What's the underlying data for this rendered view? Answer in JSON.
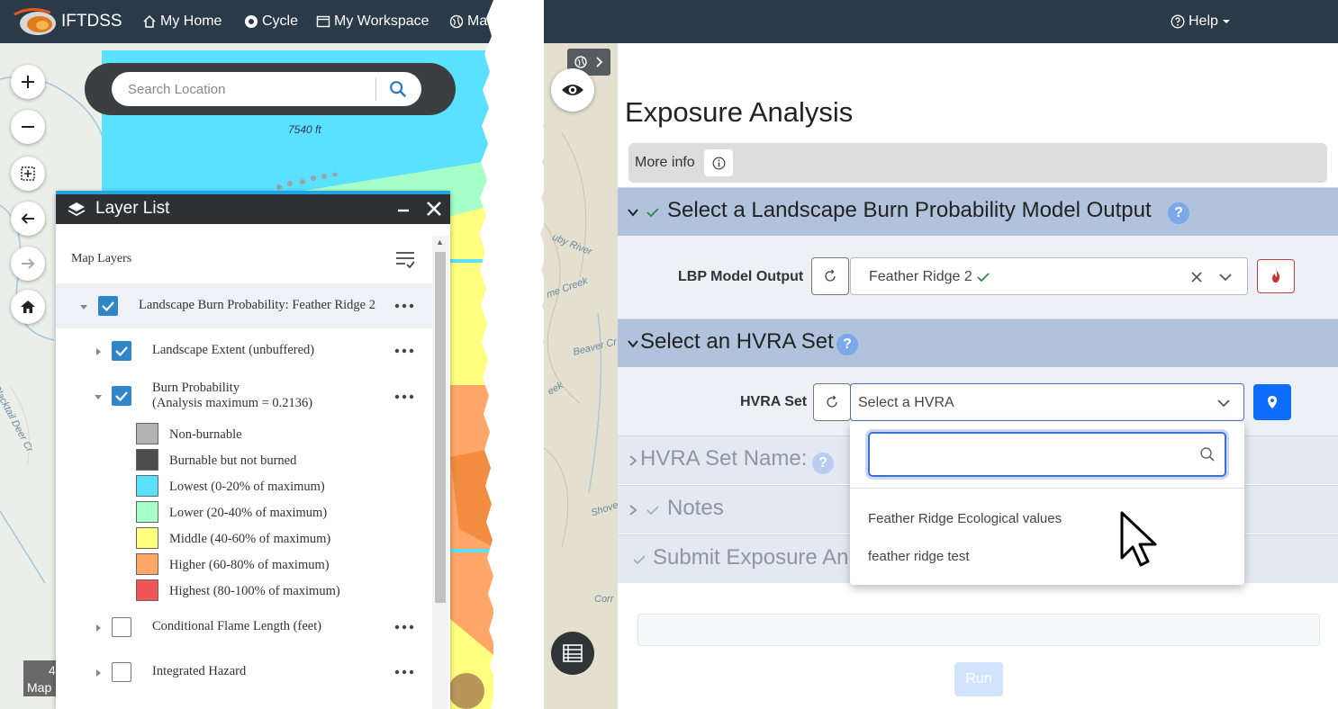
{
  "app": {
    "brand": "IFTDSS",
    "nav_left": [
      {
        "label": "My Home",
        "icon": "home-icon"
      },
      {
        "label": "Cycle",
        "icon": "cycle-icon"
      },
      {
        "label": "My Workspace",
        "icon": "workspace-icon"
      },
      {
        "label": "Ma",
        "icon": "globe-icon"
      }
    ],
    "nav_right": {
      "label": "Help",
      "icon": "question-circle-icon"
    }
  },
  "map": {
    "search_placeholder": "Search Location",
    "elevation_label": "7540 ft",
    "scale_prefix": "4",
    "map_tag": "Map",
    "map_labels_right": [
      "uby River",
      "me Creek",
      "Beaver Cr",
      "eek",
      "Shove",
      "Corr"
    ],
    "map_label_left": "Blacktail Deer Cr"
  },
  "layer_list": {
    "title": "Layer List",
    "map_layers_label": "Map Layers",
    "layers": [
      {
        "name": "Landscape Burn Probability: Feather Ridge 2",
        "checked": true
      },
      {
        "name": "Landscape Extent (unbuffered)",
        "checked": true
      },
      {
        "name": "Burn Probability",
        "sub": "(Analysis maximum = 0.2136)",
        "checked": true
      },
      {
        "name": "Conditional Flame Length (feet)",
        "checked": false
      },
      {
        "name": "Integrated Hazard",
        "checked": false
      }
    ],
    "legend": [
      {
        "label": "Non-burnable",
        "color": "#b3b3b3"
      },
      {
        "label": "Burnable but not burned",
        "color": "#4d4d4d"
      },
      {
        "label": "Lowest (0-20% of maximum)",
        "color": "#59e1ff"
      },
      {
        "label": "Lower (20-40% of maximum)",
        "color": "#a6ffc9"
      },
      {
        "label": "Middle (40-60% of maximum)",
        "color": "#ffff80"
      },
      {
        "label": "Higher (60-80% of maximum)",
        "color": "#ffa768"
      },
      {
        "label": "Highest (80-100% of maximum)",
        "color": "#f25555"
      }
    ]
  },
  "panel": {
    "title": "Exposure Analysis",
    "more_info": "More info",
    "sections": {
      "lbp": {
        "title": "Select a Landscape Burn Probability Model Output",
        "field_label": "LBP Model Output",
        "value": "Feather Ridge 2"
      },
      "hvra": {
        "title": "Select an HVRA Set",
        "field_label": "HVRA Set",
        "placeholder": "Select a HVRA"
      },
      "hvra_name": {
        "title": "HVRA Set Name:"
      },
      "notes": {
        "title": "Notes"
      },
      "submit": {
        "title": "Submit Exposure An"
      }
    },
    "dropdown_options": [
      "Feather Ridge Ecological values",
      "feather ridge test"
    ],
    "run_label": "Run"
  }
}
